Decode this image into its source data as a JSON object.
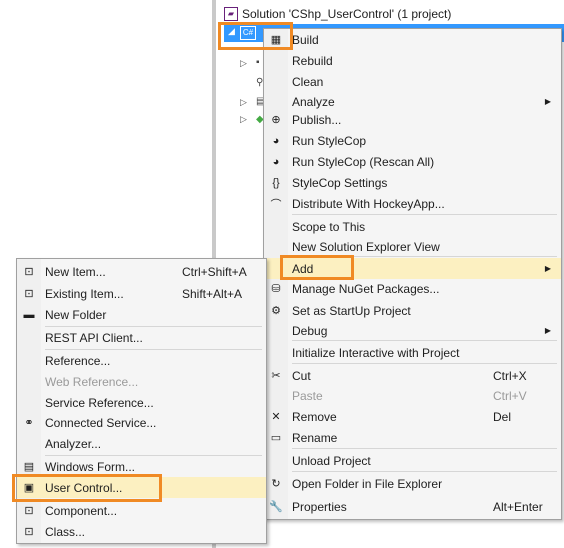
{
  "solution": {
    "title": "Solution 'CShp_UserControl' (1 project)",
    "icon": "solution-icon",
    "project_icon_text": "C#"
  },
  "context_menu": {
    "items": [
      {
        "label": "Build",
        "icon": "build-icon",
        "glyph": "▦"
      },
      {
        "label": "Rebuild",
        "icon": "",
        "glyph": ""
      },
      {
        "label": "Clean",
        "icon": "",
        "glyph": ""
      },
      {
        "label": "Analyze",
        "icon": "",
        "glyph": "",
        "submenu": true
      },
      {
        "label": "Publish...",
        "icon": "publish-icon",
        "glyph": "⊕"
      },
      {
        "label": "Run StyleCop",
        "icon": "stylecop-icon",
        "glyph": "◕"
      },
      {
        "label": "Run StyleCop (Rescan All)",
        "icon": "stylecop-rescan-icon",
        "glyph": "◕"
      },
      {
        "label": "StyleCop Settings",
        "icon": "settings-braces-icon",
        "glyph": "{}"
      },
      {
        "label": "Distribute With HockeyApp...",
        "icon": "hockeyapp-icon",
        "glyph": "⌒"
      },
      {
        "label": "Scope to This",
        "icon": "",
        "glyph": ""
      },
      {
        "label": "New Solution Explorer View",
        "icon": "",
        "glyph": ""
      },
      {
        "label": "Add",
        "icon": "",
        "glyph": "",
        "submenu": true,
        "highlighted": true
      },
      {
        "label": "Manage NuGet Packages...",
        "icon": "nuget-icon",
        "glyph": "⛁"
      },
      {
        "label": "Set as StartUp Project",
        "icon": "gear-icon",
        "glyph": "⚙"
      },
      {
        "label": "Debug",
        "icon": "",
        "glyph": "",
        "submenu": true
      },
      {
        "label": "Initialize Interactive with Project",
        "icon": "",
        "glyph": ""
      },
      {
        "label": "Cut",
        "icon": "scissors-icon",
        "glyph": "✂",
        "shortcut": "Ctrl+X"
      },
      {
        "label": "Paste",
        "icon": "",
        "glyph": "",
        "shortcut": "Ctrl+V",
        "disabled": true
      },
      {
        "label": "Remove",
        "icon": "remove-icon",
        "glyph": "✕",
        "shortcut": "Del"
      },
      {
        "label": "Rename",
        "icon": "rename-icon",
        "glyph": "▭"
      },
      {
        "label": "Unload Project",
        "icon": "",
        "glyph": ""
      },
      {
        "label": "Open Folder in File Explorer",
        "icon": "open-folder-icon",
        "glyph": "↻"
      },
      {
        "label": "Properties",
        "icon": "wrench-icon",
        "glyph": "🔧",
        "shortcut": "Alt+Enter"
      }
    ]
  },
  "add_submenu": {
    "items": [
      {
        "label": "New Item...",
        "icon": "new-item-icon",
        "glyph": "⊡",
        "shortcut": "Ctrl+Shift+A"
      },
      {
        "label": "Existing Item...",
        "icon": "existing-item-icon",
        "glyph": "⊡",
        "shortcut": "Shift+Alt+A"
      },
      {
        "label": "New Folder",
        "icon": "folder-icon",
        "glyph": "▬"
      },
      {
        "label": "REST API Client...",
        "icon": "",
        "glyph": ""
      },
      {
        "label": "Reference...",
        "icon": "",
        "glyph": ""
      },
      {
        "label": "Web Reference...",
        "icon": "",
        "glyph": "",
        "disabled": true
      },
      {
        "label": "Service Reference...",
        "icon": "",
        "glyph": ""
      },
      {
        "label": "Connected Service...",
        "icon": "connected-service-icon",
        "glyph": "⚭"
      },
      {
        "label": "Analyzer...",
        "icon": "",
        "glyph": ""
      },
      {
        "label": "Windows Form...",
        "icon": "windows-form-icon",
        "glyph": "▤"
      },
      {
        "label": "User Control...",
        "icon": "user-control-icon",
        "glyph": "▣",
        "highlighted": true
      },
      {
        "label": "Component...",
        "icon": "component-icon",
        "glyph": "⊡"
      },
      {
        "label": "Class...",
        "icon": "class-icon",
        "glyph": "⊡"
      }
    ]
  },
  "colors": {
    "highlight_box": "#f08a24",
    "selection": "#3399ff",
    "hover": "#fcf0c1"
  }
}
